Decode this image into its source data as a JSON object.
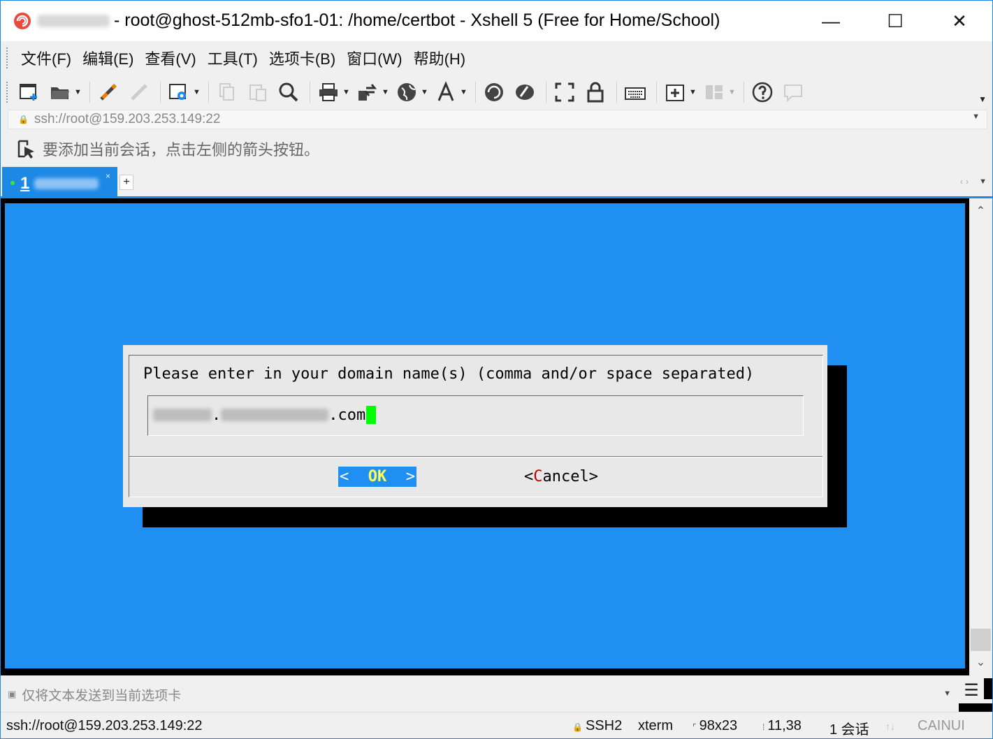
{
  "window": {
    "title": "- root@ghost-512mb-sfo1-01: /home/certbot - Xshell 5 (Free for Home/School)",
    "minimize": "—",
    "maximize": "☐",
    "close": "✕"
  },
  "menu": {
    "items": [
      "文件(F)",
      "编辑(E)",
      "查看(V)",
      "工具(T)",
      "选项卡(B)",
      "窗口(W)",
      "帮助(H)"
    ]
  },
  "toolbar": {
    "buttons": [
      "new-session-icon",
      "open-folder-icon",
      "reconnect-icon",
      "disconnect-icon",
      "properties-icon",
      "copy-icon",
      "paste-icon",
      "find-icon",
      "print-icon",
      "transfer-icon",
      "globe-icon",
      "font-icon",
      "xftp-icon",
      "xmanager-icon",
      "fullscreen-icon",
      "lock-icon",
      "keyboard-icon",
      "add-tab-icon",
      "layout-icon",
      "help-icon",
      "chat-icon"
    ]
  },
  "address": {
    "url": "ssh://root@159.203.253.149:22"
  },
  "hint": {
    "text": "要添加当前会话，点击左侧的箭头按钮。"
  },
  "tabs": {
    "active_number": "1",
    "add": "+",
    "close": "×"
  },
  "terminal": {
    "colors": {
      "background": "#1f8ff1",
      "dialog": "#e8e8e8",
      "cursor": "#00ff00"
    },
    "dialog": {
      "prompt": "Please enter in your domain name(s) (comma and/or space separated)",
      "input_dot1": ".",
      "input_dot2": ".com",
      "ok_left": "<",
      "ok_label": "OK",
      "ok_right": ">",
      "cancel_left": "<",
      "cancel_hot": "C",
      "cancel_rest": "ancel>"
    }
  },
  "compose": {
    "placeholder": "仅将文本发送到当前选项卡"
  },
  "status": {
    "connection": "ssh://root@159.203.253.149:22",
    "protocol": "SSH2",
    "terminal_type": "xterm",
    "size": "98x23",
    "cursor_pos": "11,38",
    "sessions": "1 会话",
    "caps": "CAINUI"
  }
}
